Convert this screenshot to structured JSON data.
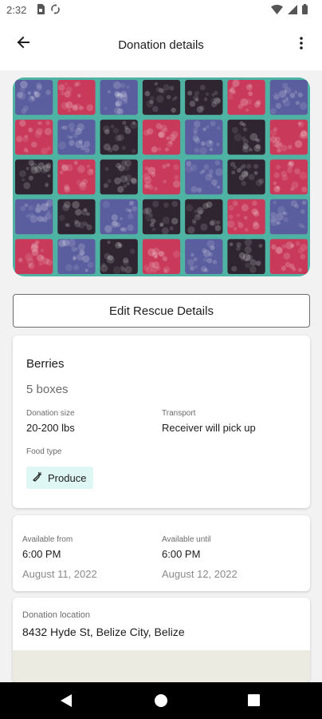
{
  "status_bar": {
    "time": "2:32",
    "left_icons": [
      "sim-card-icon",
      "sync-icon"
    ],
    "right_icons": [
      "wifi-icon",
      "signal-icon",
      "battery-icon"
    ]
  },
  "app_bar": {
    "title": "Donation details",
    "back_icon": "arrow-back-icon",
    "menu_icon": "more-vert-icon"
  },
  "hero_image": {
    "subject": "berry-baskets-photo",
    "colors": {
      "basket": "#4fb3a4",
      "blueberry": "#5b5e9e",
      "raspberry": "#c93a5a",
      "blackberry": "#2e2530"
    }
  },
  "edit_button": {
    "label": "Edit Rescue Details"
  },
  "food": {
    "name": "Berries",
    "quantity": "5 boxes",
    "size_label": "Donation size",
    "size_value": "20-200 lbs",
    "transport_label": "Transport",
    "transport_value": "Receiver will pick up",
    "type_label": "Food type",
    "type_chip": {
      "label": "Produce",
      "icon": "carrot-icon",
      "color": "#dff7f4"
    }
  },
  "availability": {
    "from_label": "Available from",
    "from_time": "6:00 PM",
    "from_date": "August 11, 2022",
    "until_label": "Available until",
    "until_time": "6:00 PM",
    "until_date": "August 12, 2022"
  },
  "location": {
    "label": "Donation location",
    "address": "8432 Hyde St, Belize City, Belize"
  },
  "nav_bar": {
    "icons": [
      "nav-back-icon",
      "nav-home-icon",
      "nav-recents-icon"
    ]
  }
}
